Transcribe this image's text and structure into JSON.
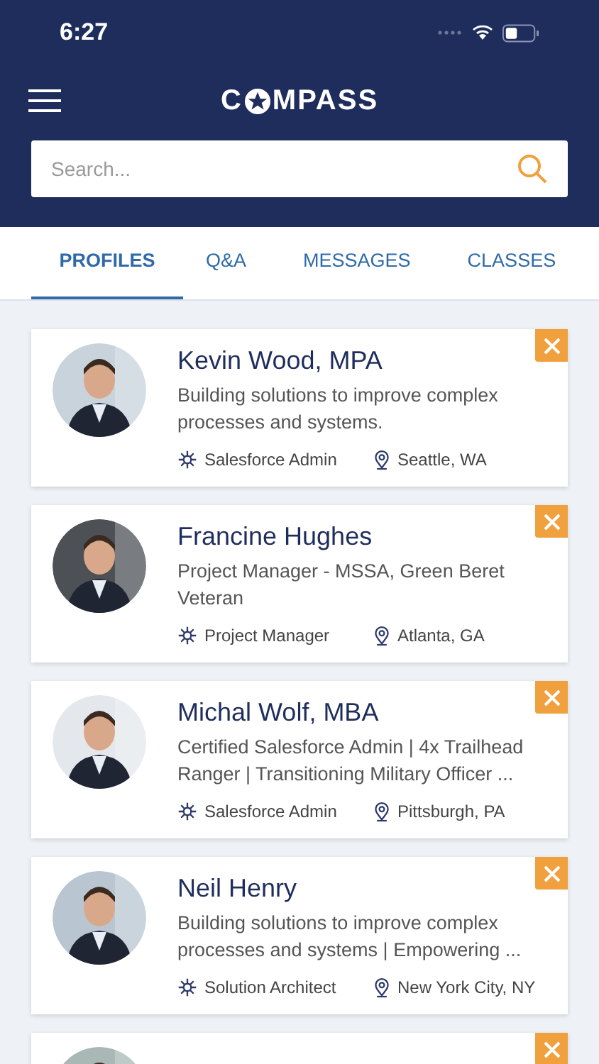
{
  "status_bar": {
    "time": "6:27"
  },
  "header": {
    "logo": {
      "before": "C",
      "after": "MPASS"
    }
  },
  "search": {
    "placeholder": "Search..."
  },
  "tabs": [
    {
      "label": "PROFILES",
      "selected": true
    },
    {
      "label": "Q&A",
      "selected": false
    },
    {
      "label": "MESSAGES",
      "selected": false
    },
    {
      "label": "CLASSES",
      "selected": false
    }
  ],
  "profiles": [
    {
      "kind": "full",
      "name": "Kevin Wood, MPA",
      "headline": "Building solutions to improve complex processes and systems.",
      "role": "Salesforce Admin",
      "location": "Seattle, WA"
    },
    {
      "kind": "full",
      "name": "Francine Hughes",
      "headline": "Project Manager - MSSA, Green Beret Veteran",
      "role": "Project Manager",
      "location": "Atlanta, GA"
    },
    {
      "kind": "full",
      "name": "Michal Wolf, MBA",
      "headline": "Certified Salesforce Admin | 4x Trailhead Ranger | Transitioning Military Officer ...",
      "role": "Salesforce Admin",
      "location": "Pittsburgh, PA"
    },
    {
      "kind": "full",
      "name": "Neil Henry",
      "headline": "Building solutions to improve complex processes and systems | Empowering ...",
      "role": "Solution Architect",
      "location": "New York City, NY"
    },
    {
      "kind": "cut"
    }
  ]
}
